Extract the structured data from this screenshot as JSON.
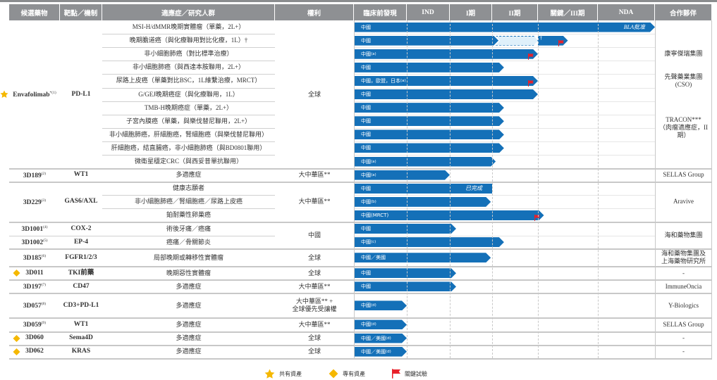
{
  "headers": [
    "候選藥物",
    "靶點／機制",
    "適應症／研究人群",
    "權利",
    "臨床前發現",
    "IND",
    "I期",
    "II期",
    "關鍵／III期",
    "NDA",
    "合作夥伴"
  ],
  "colors": {
    "header_bg": "#8e9093",
    "bar": "#1470b8",
    "flag": "#e8202a",
    "star": "#f5b800",
    "diamond": "#f5b800"
  },
  "groups": [
    {
      "rights": "全球",
      "partners": [
        {
          "lines": [
            "康寧傑瑞集團"
          ],
          "rows": [
            2,
            2
          ]
        },
        {
          "lines": [
            "先聲藥業集團",
            "(CSO)"
          ],
          "rows": [
            3,
            5
          ]
        },
        {
          "lines": [
            "TRACON***",
            "（肉瘤適應症，II期）"
          ],
          "rows": [
            7,
            8
          ]
        }
      ],
      "candidates": [
        {
          "name": "Envafolimab",
          "sup": "*(1)",
          "asset": "star",
          "target": "PD-L1",
          "indications": [
            {
              "text": "MSI-H/dMMR晚期實體瘤（單藥，2L+）",
              "bar": {
                "label": "中國",
                "end": 6.0,
                "note": "BLA批准"
              }
            },
            {
              "text": "晚期膽道癌（與化療聯用對比化療，1L）†",
              "bar": {
                "label": "中國",
                "end": 3.14,
                "dashed_to": 4.0,
                "ext_end": 4.5,
                "ext_note": "†",
                "flag": true
              }
            },
            {
              "text": "非小細胞肺癌（對比標準治療）",
              "bar": {
                "label": "中國",
                "sup": "(a)",
                "end": 4.0,
                "flag": true
              }
            },
            {
              "text": "非小細胞肺癌（與西達本胺聯用，2L+）",
              "bar": {
                "label": "中國",
                "end": 3.26
              }
            },
            {
              "text": "尿路上皮癌（單藥對比BSC，1L維繫治療，MRCT）",
              "bar": {
                "label": "中國，歐盟，日本",
                "sup": "(a)",
                "end": 4.0,
                "flag": true
              }
            },
            {
              "text": "G/GEJ晚期癌症（與化療聯用，1L）",
              "bar": {
                "label": "中國",
                "end": 4.0
              }
            },
            {
              "text": "TMB-H晚期癌症（單藥，2L+）",
              "bar": {
                "label": "中國",
                "end": 3.26
              }
            },
            {
              "text": "子宮內膜癌（單藥，與樂伐替尼聯用，2L+）",
              "bar": {
                "label": "中國",
                "end": 3.26
              }
            },
            {
              "text": "非小細胞肺癌，肝細胞癌，腎細胞癌（與樂伐替尼聯用）",
              "bar": {
                "label": "中國",
                "end": 3.26
              }
            },
            {
              "text": "肝細胞癌，結直腸癌，非小細胞肺癌（與BD0801聯用）",
              "bar": {
                "label": "中國",
                "end": 3.26
              }
            },
            {
              "text": "微衛星穩定CRC（與西妥昔單抗聯用）",
              "bar": {
                "label": "中國",
                "sup": "(a)",
                "end": 3.08
              }
            }
          ]
        }
      ]
    },
    {
      "rights": "大中華區**",
      "partners": [
        {
          "lines": [
            "SELLAS Group"
          ],
          "rows": [
            0,
            0
          ]
        }
      ],
      "candidates": [
        {
          "name": "3D189",
          "sup": "(2)",
          "target": "WT1",
          "indications": [
            {
              "text": "多適應症",
              "bar": {
                "label": "中國",
                "sup": "(a)",
                "end": 2.0
              }
            }
          ]
        }
      ]
    },
    {
      "rights": "大中華區**",
      "partners": [
        {
          "lines": [
            "Aravive"
          ],
          "rows": [
            0,
            2
          ]
        }
      ],
      "candidates": [
        {
          "name": "3D229",
          "sup": "(3)",
          "target": "GAS6/AXL",
          "indications": [
            {
              "text": "健康志願者",
              "bar": {
                "label": "中國",
                "end": 3.0,
                "flat": true,
                "note": "已完成"
              }
            },
            {
              "text": "非小細胞肺癌／腎細胞癌／尿路上皮癌",
              "bar": {
                "label": "中國",
                "sup": "(b)",
                "end": 2.97
              }
            },
            {
              "text": "鉑耐藥性卵巢癌",
              "bar": {
                "label": "中國(MRCT)",
                "end": 4.1,
                "flag": true
              }
            }
          ]
        }
      ]
    },
    {
      "rights": "中國",
      "partners": [
        {
          "lines": [
            "海和藥物集團"
          ],
          "rows": [
            0,
            1
          ]
        }
      ],
      "candidates": [
        {
          "name": "3D1001",
          "sup": "(4)",
          "target": "COX-2",
          "indications": [
            {
              "text": "術後牙痛／癌痛",
              "bar": {
                "label": "中國",
                "end": 2.15
              }
            }
          ]
        },
        {
          "name": "3D1002",
          "sup": "(5)",
          "target": "EP-4",
          "indications": [
            {
              "text": "癌痛／骨關節炎",
              "bar": {
                "label": "中國",
                "sup": "(c)",
                "end": 3.26
              }
            }
          ]
        }
      ]
    },
    {
      "rights": "全球",
      "partners": [
        {
          "lines": [
            "海和藥物集團及",
            "上海藥物研究所"
          ],
          "rows": [
            0,
            0
          ]
        }
      ],
      "candidates": [
        {
          "name": "3D185",
          "sup": "(6)",
          "target": "FGFR1/2/3",
          "tall": 25,
          "indications": [
            {
              "text": "局部晚期或轉移性實體瘤",
              "bar": {
                "label": "中國／美國",
                "end": 2.97
              }
            }
          ]
        }
      ]
    },
    {
      "rights": "全球",
      "partners": [
        {
          "lines": [
            "-"
          ],
          "rows": [
            0,
            0
          ]
        }
      ],
      "candidates": [
        {
          "name": "3D011",
          "asset": "diamond",
          "target": "TKI前藥",
          "indications": [
            {
              "text": "晚期惡性實體瘤",
              "bar": {
                "label": "中國",
                "end": 2.15
              }
            }
          ]
        }
      ]
    },
    {
      "rights": "大中華區**",
      "partners": [
        {
          "lines": [
            "ImmuneOncia"
          ],
          "rows": [
            0,
            0
          ]
        }
      ],
      "candidates": [
        {
          "name": "3D197",
          "sup": "(7)",
          "target": "CD47",
          "indications": [
            {
              "text": "多適應症",
              "bar": {
                "label": "中國",
                "end": 2.15
              }
            }
          ]
        }
      ]
    },
    {
      "rights": "大中華區** +\n全球優先受讓權",
      "partners": [
        {
          "lines": [
            "Y-Biologics"
          ],
          "rows": [
            0,
            0
          ]
        }
      ],
      "candidates": [
        {
          "name": "3D057",
          "sup": "(8)",
          "target": "CD3+PD-L1",
          "tall": 35,
          "indications": [
            {
              "text": "多適應症",
              "bar": {
                "label": "中國",
                "sup": "(d)",
                "end": 1.0
              }
            }
          ]
        }
      ]
    },
    {
      "rights": "大中華區**",
      "partners": [
        {
          "lines": [
            "SELLAS Group"
          ],
          "rows": [
            0,
            0
          ]
        }
      ],
      "candidates": [
        {
          "name": "3D059",
          "sup": "(9)",
          "target": "WT1",
          "indications": [
            {
              "text": "多適應症",
              "bar": {
                "label": "中國",
                "sup": "(d)",
                "end": 1.0
              }
            }
          ]
        }
      ]
    },
    {
      "rights": "全球",
      "partners": [
        {
          "lines": [
            "-"
          ],
          "rows": [
            0,
            0
          ]
        }
      ],
      "candidates": [
        {
          "name": "3D060",
          "asset": "diamond",
          "target": "Sema4D",
          "indications": [
            {
              "text": "多適應症",
              "bar": {
                "label": "中國／美國",
                "sup": "(d)",
                "end": 1.0
              }
            }
          ]
        }
      ]
    },
    {
      "rights": "全球",
      "partners": [
        {
          "lines": [
            "-"
          ],
          "rows": [
            0,
            0
          ]
        }
      ],
      "candidates": [
        {
          "name": "3D062",
          "asset": "diamond",
          "target": "KRAS",
          "indications": [
            {
              "text": "多適應症",
              "bar": {
                "label": "中國／美國",
                "sup": "(d)",
                "end": 1.0
              }
            }
          ]
        }
      ]
    }
  ],
  "legend": [
    {
      "icon": "star",
      "label": "共有資產"
    },
    {
      "icon": "diamond",
      "label": "專有資產"
    },
    {
      "icon": "flag",
      "label": "關鍵試驗"
    }
  ]
}
